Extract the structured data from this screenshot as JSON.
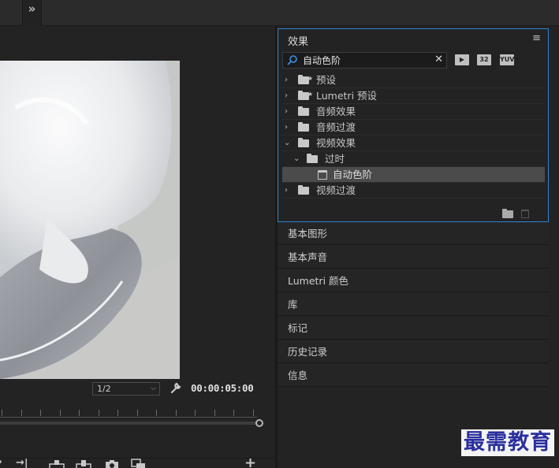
{
  "top": {
    "overflow_label": "»"
  },
  "monitor": {
    "resolution": "1/2",
    "timecode": "00:00:05:00"
  },
  "effects": {
    "title": "效果",
    "menu_icon": "hamburger-icon",
    "search_value": "自动色阶",
    "filters": [
      "accelerated-effects-icon",
      "32",
      "YUV"
    ],
    "tree": [
      {
        "label": "预设",
        "expanded": false,
        "level": 0,
        "type": "preset-folder"
      },
      {
        "label": "Lumetri 预设",
        "expanded": false,
        "level": 0,
        "type": "preset-folder"
      },
      {
        "label": "音频效果",
        "expanded": false,
        "level": 0,
        "type": "folder"
      },
      {
        "label": "音频过渡",
        "expanded": false,
        "level": 0,
        "type": "folder"
      },
      {
        "label": "视频效果",
        "expanded": true,
        "level": 0,
        "type": "folder"
      },
      {
        "label": "过时",
        "expanded": true,
        "level": 1,
        "type": "folder"
      },
      {
        "label": "自动色阶",
        "expanded": false,
        "level": 2,
        "type": "effect",
        "selected": true
      },
      {
        "label": "视频过渡",
        "expanded": false,
        "level": 0,
        "type": "folder"
      }
    ]
  },
  "panels": [
    "基本图形",
    "基本声音",
    "Lumetri 颜色",
    "库",
    "标记",
    "历史记录",
    "信息"
  ],
  "watermark": "最需教育",
  "colors": {
    "accent": "#2c84d5",
    "watermark": "#2a2f9e"
  }
}
